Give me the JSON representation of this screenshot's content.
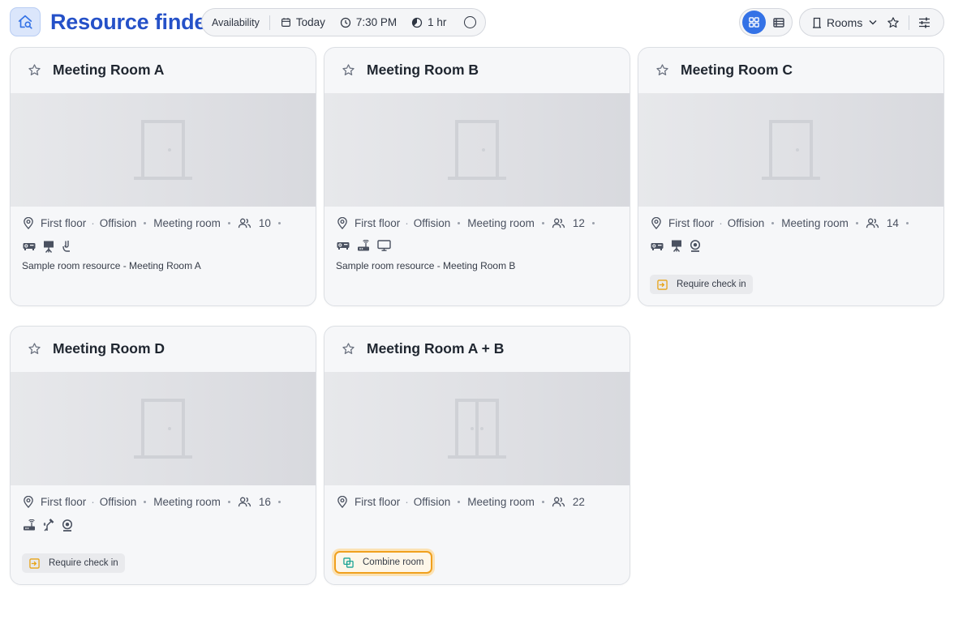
{
  "header": {
    "title": "Resource finder",
    "filters": {
      "availability_label": "Availability",
      "date": "Today",
      "time": "7:30 PM",
      "duration": "1 hr"
    },
    "resource_type": "Rooms",
    "view_mode": "grid"
  },
  "rooms": [
    {
      "name": "Meeting Room A",
      "floor": "First floor",
      "building": "Offision",
      "type": "Meeting room",
      "capacity": "10",
      "amenities": [
        "projector-icon",
        "whiteboard-icon",
        "microphone-icon"
      ],
      "description": "Sample room resource - Meeting Room A",
      "tag": ""
    },
    {
      "name": "Meeting Room B",
      "floor": "First floor",
      "building": "Offision",
      "type": "Meeting room",
      "capacity": "12",
      "amenities": [
        "projector-icon",
        "router-icon",
        "monitor-icon"
      ],
      "description": "Sample room resource - Meeting Room B",
      "tag": ""
    },
    {
      "name": "Meeting Room C",
      "floor": "First floor",
      "building": "Offision",
      "type": "Meeting room",
      "capacity": "14",
      "amenities": [
        "projector-icon",
        "whiteboard-icon",
        "webcam-icon"
      ],
      "description": "",
      "tag": "Require check in"
    },
    {
      "name": "Meeting Room D",
      "floor": "First floor",
      "building": "Offision",
      "type": "Meeting room",
      "capacity": "16",
      "amenities": [
        "router-icon",
        "mic-stand-icon",
        "webcam-icon"
      ],
      "description": "",
      "tag": "Require check in"
    },
    {
      "name": "Meeting Room A + B",
      "floor": "First floor",
      "building": "Offision",
      "type": "Meeting room",
      "capacity": "22",
      "amenities": [],
      "description": "",
      "tag": "Combine room"
    }
  ],
  "colors": {
    "brand": "#2551c8",
    "accent": "#3472e6",
    "checkin_icon": "#e8a317",
    "combine_icon": "#1aa394",
    "combine_border": "#f0a01e"
  }
}
